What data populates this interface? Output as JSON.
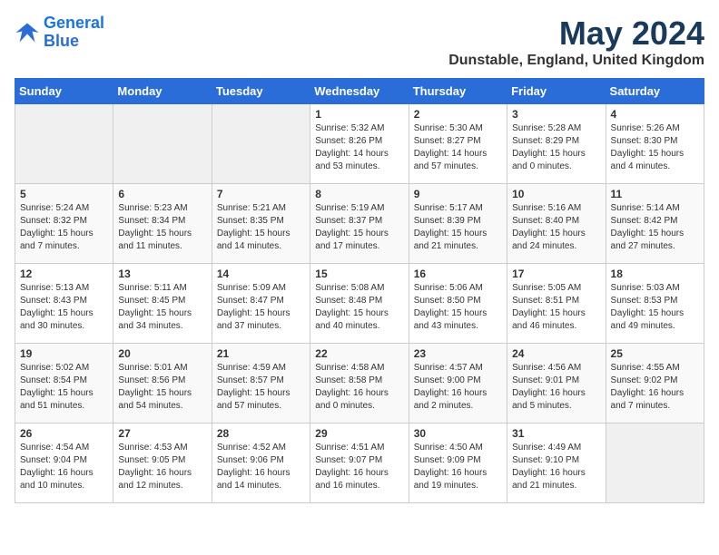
{
  "logo": {
    "line1": "General",
    "line2": "Blue"
  },
  "title": "May 2024",
  "location": "Dunstable, England, United Kingdom",
  "days_header": [
    "Sunday",
    "Monday",
    "Tuesday",
    "Wednesday",
    "Thursday",
    "Friday",
    "Saturday"
  ],
  "weeks": [
    [
      {
        "num": "",
        "info": ""
      },
      {
        "num": "",
        "info": ""
      },
      {
        "num": "",
        "info": ""
      },
      {
        "num": "1",
        "info": "Sunrise: 5:32 AM\nSunset: 8:26 PM\nDaylight: 14 hours\nand 53 minutes."
      },
      {
        "num": "2",
        "info": "Sunrise: 5:30 AM\nSunset: 8:27 PM\nDaylight: 14 hours\nand 57 minutes."
      },
      {
        "num": "3",
        "info": "Sunrise: 5:28 AM\nSunset: 8:29 PM\nDaylight: 15 hours\nand 0 minutes."
      },
      {
        "num": "4",
        "info": "Sunrise: 5:26 AM\nSunset: 8:30 PM\nDaylight: 15 hours\nand 4 minutes."
      }
    ],
    [
      {
        "num": "5",
        "info": "Sunrise: 5:24 AM\nSunset: 8:32 PM\nDaylight: 15 hours\nand 7 minutes."
      },
      {
        "num": "6",
        "info": "Sunrise: 5:23 AM\nSunset: 8:34 PM\nDaylight: 15 hours\nand 11 minutes."
      },
      {
        "num": "7",
        "info": "Sunrise: 5:21 AM\nSunset: 8:35 PM\nDaylight: 15 hours\nand 14 minutes."
      },
      {
        "num": "8",
        "info": "Sunrise: 5:19 AM\nSunset: 8:37 PM\nDaylight: 15 hours\nand 17 minutes."
      },
      {
        "num": "9",
        "info": "Sunrise: 5:17 AM\nSunset: 8:39 PM\nDaylight: 15 hours\nand 21 minutes."
      },
      {
        "num": "10",
        "info": "Sunrise: 5:16 AM\nSunset: 8:40 PM\nDaylight: 15 hours\nand 24 minutes."
      },
      {
        "num": "11",
        "info": "Sunrise: 5:14 AM\nSunset: 8:42 PM\nDaylight: 15 hours\nand 27 minutes."
      }
    ],
    [
      {
        "num": "12",
        "info": "Sunrise: 5:13 AM\nSunset: 8:43 PM\nDaylight: 15 hours\nand 30 minutes."
      },
      {
        "num": "13",
        "info": "Sunrise: 5:11 AM\nSunset: 8:45 PM\nDaylight: 15 hours\nand 34 minutes."
      },
      {
        "num": "14",
        "info": "Sunrise: 5:09 AM\nSunset: 8:47 PM\nDaylight: 15 hours\nand 37 minutes."
      },
      {
        "num": "15",
        "info": "Sunrise: 5:08 AM\nSunset: 8:48 PM\nDaylight: 15 hours\nand 40 minutes."
      },
      {
        "num": "16",
        "info": "Sunrise: 5:06 AM\nSunset: 8:50 PM\nDaylight: 15 hours\nand 43 minutes."
      },
      {
        "num": "17",
        "info": "Sunrise: 5:05 AM\nSunset: 8:51 PM\nDaylight: 15 hours\nand 46 minutes."
      },
      {
        "num": "18",
        "info": "Sunrise: 5:03 AM\nSunset: 8:53 PM\nDaylight: 15 hours\nand 49 minutes."
      }
    ],
    [
      {
        "num": "19",
        "info": "Sunrise: 5:02 AM\nSunset: 8:54 PM\nDaylight: 15 hours\nand 51 minutes."
      },
      {
        "num": "20",
        "info": "Sunrise: 5:01 AM\nSunset: 8:56 PM\nDaylight: 15 hours\nand 54 minutes."
      },
      {
        "num": "21",
        "info": "Sunrise: 4:59 AM\nSunset: 8:57 PM\nDaylight: 15 hours\nand 57 minutes."
      },
      {
        "num": "22",
        "info": "Sunrise: 4:58 AM\nSunset: 8:58 PM\nDaylight: 16 hours\nand 0 minutes."
      },
      {
        "num": "23",
        "info": "Sunrise: 4:57 AM\nSunset: 9:00 PM\nDaylight: 16 hours\nand 2 minutes."
      },
      {
        "num": "24",
        "info": "Sunrise: 4:56 AM\nSunset: 9:01 PM\nDaylight: 16 hours\nand 5 minutes."
      },
      {
        "num": "25",
        "info": "Sunrise: 4:55 AM\nSunset: 9:02 PM\nDaylight: 16 hours\nand 7 minutes."
      }
    ],
    [
      {
        "num": "26",
        "info": "Sunrise: 4:54 AM\nSunset: 9:04 PM\nDaylight: 16 hours\nand 10 minutes."
      },
      {
        "num": "27",
        "info": "Sunrise: 4:53 AM\nSunset: 9:05 PM\nDaylight: 16 hours\nand 12 minutes."
      },
      {
        "num": "28",
        "info": "Sunrise: 4:52 AM\nSunset: 9:06 PM\nDaylight: 16 hours\nand 14 minutes."
      },
      {
        "num": "29",
        "info": "Sunrise: 4:51 AM\nSunset: 9:07 PM\nDaylight: 16 hours\nand 16 minutes."
      },
      {
        "num": "30",
        "info": "Sunrise: 4:50 AM\nSunset: 9:09 PM\nDaylight: 16 hours\nand 19 minutes."
      },
      {
        "num": "31",
        "info": "Sunrise: 4:49 AM\nSunset: 9:10 PM\nDaylight: 16 hours\nand 21 minutes."
      },
      {
        "num": "",
        "info": ""
      }
    ]
  ]
}
